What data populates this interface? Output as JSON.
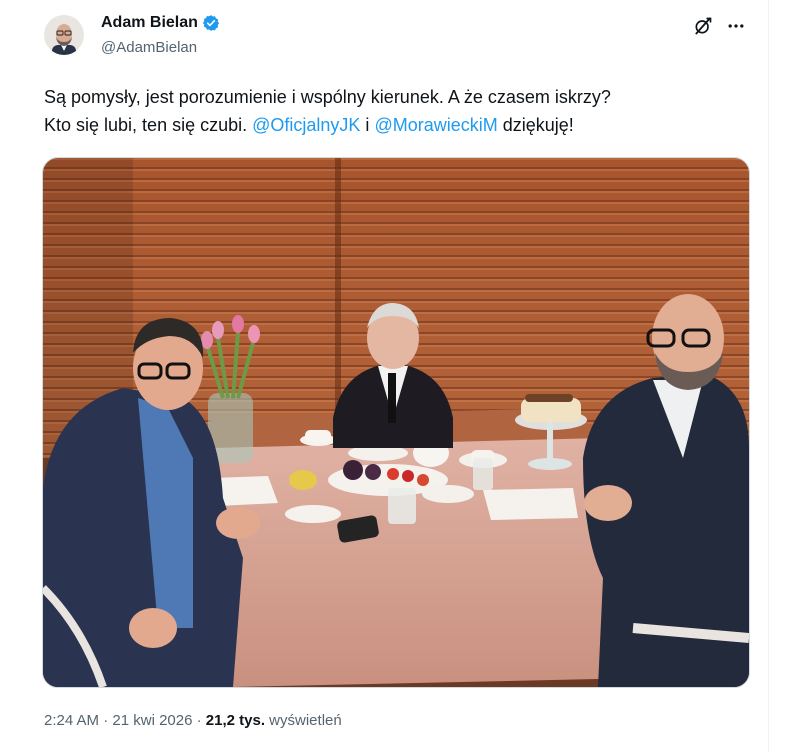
{
  "author": {
    "name": "Adam Bielan",
    "handle": "@AdamBielan",
    "verified_color": "#1d9bf0"
  },
  "tweet": {
    "text_line1": "Są pomysły, jest porozumienie i wspólny kierunek. A że czasem iskrzy?",
    "text_line2_prefix": "Kto się lubi, ten się czubi. ",
    "mention1": "@OficjalnyJK",
    "connector": " i ",
    "mention2": "@MorawieckiM",
    "suffix": " dziękuję!"
  },
  "meta": {
    "time": "2:24 AM",
    "sep": " · ",
    "date": "21 kwi 2026",
    "views_count": "21,2 tys.",
    "views_label": " wyświetleń"
  },
  "icons": {
    "grok": "grok-icon",
    "more": "more-icon"
  },
  "colors": {
    "accent": "#1d9bf0",
    "muted": "#536471",
    "text": "#0f1419"
  }
}
